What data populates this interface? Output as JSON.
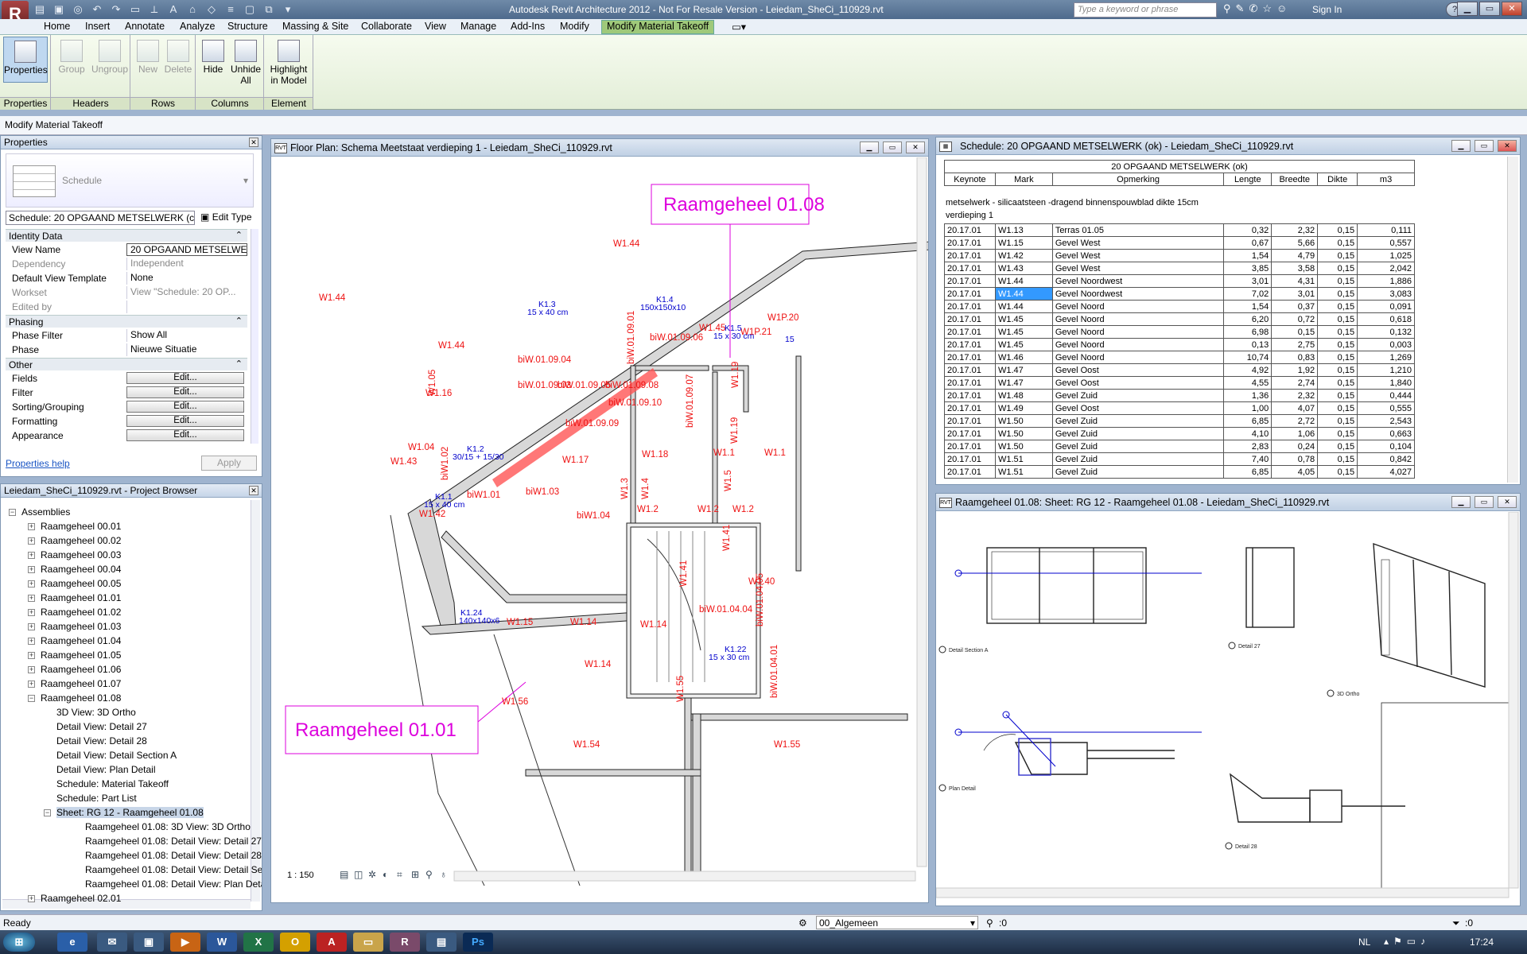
{
  "window": {
    "title": "Autodesk Revit Architecture 2012 - Not For Resale Version -    Leiedam_SheCi_110929.rvt",
    "search_placeholder": "Type a keyword or phrase",
    "sign_in": "Sign In",
    "logo": "R"
  },
  "tabs": [
    "Home",
    "Insert",
    "Annotate",
    "Analyze",
    "Structure",
    "Massing & Site",
    "Collaborate",
    "View",
    "Manage",
    "Add-Ins",
    "Modify",
    "Modify Material Takeoff"
  ],
  "ribbon": {
    "properties": {
      "btn": "Properties",
      "panel": "Properties"
    },
    "headers": {
      "group": "Group",
      "ungroup": "Ungroup",
      "panel": "Headers"
    },
    "rows": {
      "new": "New",
      "delete": "Delete",
      "panel": "Rows"
    },
    "columns": {
      "hide": "Hide",
      "unhide": "Unhide",
      "unhide2": "All",
      "panel": "Columns"
    },
    "element": {
      "highlight": "Highlight",
      "highlight2": "in Model",
      "panel": "Element"
    }
  },
  "context_label": "Modify Material Takeoff",
  "properties": {
    "title": "Properties",
    "type_name": "Schedule",
    "selector": "Schedule: 20 OPGAAND METSELWERK (c",
    "edit_type": "Edit Type",
    "groups": {
      "identity": "Identity Data",
      "phasing": "Phasing",
      "other": "Other"
    },
    "rows": [
      {
        "k": "View Name",
        "v": "20 OPGAAND METSELWE..."
      },
      {
        "k": "Dependency",
        "v": "Independent"
      },
      {
        "k": "Default View Template",
        "v": "None"
      },
      {
        "k": "Workset",
        "v": "View \"Schedule: 20 OP..."
      },
      {
        "k": "Edited by",
        "v": ""
      },
      {
        "k": "Phase Filter",
        "v": "Show All"
      },
      {
        "k": "Phase",
        "v": "Nieuwe Situatie"
      }
    ],
    "edit_rows": [
      "Fields",
      "Filter",
      "Sorting/Grouping",
      "Formatting",
      "Appearance"
    ],
    "edit_label": "Edit...",
    "help": "Properties help",
    "apply": "Apply"
  },
  "browser": {
    "title": "Leiedam_SheCi_110929.rvt - Project Browser",
    "root": "Assemblies",
    "items": [
      "Raamgeheel 00.01",
      "Raamgeheel 00.02",
      "Raamgeheel 00.03",
      "Raamgeheel 00.04",
      "Raamgeheel 00.05",
      "Raamgeheel 01.01",
      "Raamgeheel 01.02",
      "Raamgeheel 01.03",
      "Raamgeheel 01.04",
      "Raamgeheel 01.05",
      "Raamgeheel 01.06",
      "Raamgeheel 01.07",
      "Raamgeheel 01.08"
    ],
    "children": [
      "3D View: 3D Ortho",
      "Detail View: Detail 27",
      "Detail View: Detail 28",
      "Detail View: Detail Section A",
      "Detail View: Plan Detail",
      "Schedule: Material Takeoff",
      "Schedule: Part List"
    ],
    "sheet": "Sheet: RG 12 - Raamgeheel 01.08",
    "sheet_children": [
      "Raamgeheel 01.08: 3D View: 3D Ortho",
      "Raamgeheel 01.08: Detail View: Detail 27",
      "Raamgeheel 01.08: Detail View: Detail 28",
      "Raamgeheel 01.08: Detail View: Detail Section A",
      "Raamgeheel 01.08: Detail View: Plan Detail"
    ],
    "last": "Raamgeheel 02.01"
  },
  "floorplan": {
    "title": "Floor Plan: Schema Meetstaat verdieping 1 - Leiedam_SheCi_110929.rvt",
    "scale": "1 : 150",
    "tag1": "Raamgeheel 01.08",
    "tag2": "Raamgeheel 01.01",
    "labels": [
      "W1.44",
      "W1.44",
      "W1.44",
      "W1.43",
      "W1.16",
      "W1.04",
      "W1.42",
      "W1.05",
      "biW1.02",
      "biW1.01",
      "biW1.03",
      "biW1.04",
      "W1.17",
      "W1.18",
      "W1.1",
      "W1.1",
      "W1.3",
      "W1.4",
      "W1.5",
      "W1.2",
      "W1.2",
      "W1.2",
      "W1.45",
      "W1P.21",
      "W1P.20",
      "W1.19",
      "W1.19",
      "W1.41",
      "W1.41",
      "W1.40",
      "W1.15",
      "W1.14",
      "W1.14",
      "W1.14",
      "W1.55",
      "W1.56",
      "W1.54",
      "W1.55",
      "biW.01.09.04",
      "biW.01.09.03",
      "biW.01.09.05",
      "biW.01.09.06",
      "biW.01.09.08",
      "biW.01.09.09",
      "biW.01.09.10",
      "biW.01.09.01",
      "biW.01.09.07",
      "biW.01.04.04",
      "biW.01.04.05",
      "biW.01.04.01"
    ],
    "blue": [
      "K1.3",
      "15 x 40 cm",
      "K1.4",
      "150x150x10",
      "K1.5",
      "15 x 30 cm",
      "K1.2",
      "30/15 + 15/30",
      "K1.1",
      "15 x 40 cm",
      "K1.24",
      "140x140x6",
      "K1.22",
      "15 x 30 cm",
      "15"
    ]
  },
  "schedule": {
    "window_title": "Schedule: 20 OPGAAND METSELWERK (ok) - Leiedam_SheCi_110929.rvt",
    "title": "20 OPGAAND METSELWERK (ok)",
    "columns": [
      "Keynote",
      "Mark",
      "Opmerking",
      "Lengte",
      "Breedte",
      "Dikte",
      "m3"
    ],
    "group": "metselwerk - silicaatsteen -dragend binnenspouwblad dikte 15cm",
    "level": "verdieping 1",
    "rows": [
      [
        "20.17.01",
        "W1.13",
        "Terras 01.05",
        "0,32",
        "2,32",
        "0,15",
        "0,111"
      ],
      [
        "20.17.01",
        "W1.15",
        "Gevel West",
        "0,67",
        "5,66",
        "0,15",
        "0,557"
      ],
      [
        "20.17.01",
        "W1.42",
        "Gevel West",
        "1,54",
        "4,79",
        "0,15",
        "1,025"
      ],
      [
        "20.17.01",
        "W1.43",
        "Gevel West",
        "3,85",
        "3,58",
        "0,15",
        "2,042"
      ],
      [
        "20.17.01",
        "W1.44",
        "Gevel Noordwest",
        "3,01",
        "4,31",
        "0,15",
        "1,886"
      ],
      [
        "20.17.01",
        "W1.44",
        "Gevel Noordwest",
        "7,02",
        "3,01",
        "0,15",
        "3,083"
      ],
      [
        "20.17.01",
        "W1.44",
        "Gevel Noord",
        "1,54",
        "0,37",
        "0,15",
        "0,091"
      ],
      [
        "20.17.01",
        "W1.45",
        "Gevel Noord",
        "6,20",
        "0,72",
        "0,15",
        "0,618"
      ],
      [
        "20.17.01",
        "W1.45",
        "Gevel Noord",
        "6,98",
        "0,15",
        "0,15",
        "0,132"
      ],
      [
        "20.17.01",
        "W1.45",
        "Gevel Noord",
        "0,13",
        "2,75",
        "0,15",
        "0,003"
      ],
      [
        "20.17.01",
        "W1.46",
        "Gevel Noord",
        "10,74",
        "0,83",
        "0,15",
        "1,269"
      ],
      [
        "20.17.01",
        "W1.47",
        "Gevel Oost",
        "4,92",
        "1,92",
        "0,15",
        "1,210"
      ],
      [
        "20.17.01",
        "W1.47",
        "Gevel Oost",
        "4,55",
        "2,74",
        "0,15",
        "1,840"
      ],
      [
        "20.17.01",
        "W1.48",
        "Gevel Zuid",
        "1,36",
        "2,32",
        "0,15",
        "0,444"
      ],
      [
        "20.17.01",
        "W1.49",
        "Gevel Oost",
        "1,00",
        "4,07",
        "0,15",
        "0,555"
      ],
      [
        "20.17.01",
        "W1.50",
        "Gevel Zuid",
        "6,85",
        "2,72",
        "0,15",
        "2,543"
      ],
      [
        "20.17.01",
        "W1.50",
        "Gevel Zuid",
        "4,10",
        "1,06",
        "0,15",
        "0,663"
      ],
      [
        "20.17.01",
        "W1.50",
        "Gevel Zuid",
        "2,83",
        "0,24",
        "0,15",
        "0,104"
      ],
      [
        "20.17.01",
        "W1.51",
        "Gevel Zuid",
        "7,40",
        "0,78",
        "0,15",
        "0,842"
      ],
      [
        "20.17.01",
        "W1.51",
        "Gevel Zuid",
        "6,85",
        "4,05",
        "0,15",
        "4,027"
      ]
    ],
    "selected_mark_row": 5
  },
  "sheet": {
    "window_title": "Raamgeheel 01.08: Sheet: RG 12 - Raamgeheel 01.08 - Leiedam_SheCi_110929.rvt",
    "vp_labels": [
      "Detail Section A",
      "Detail 27",
      "3D Ortho",
      "Plan Detail",
      "Detail 28"
    ]
  },
  "status": {
    "text": "Ready",
    "workset": "00_Algemeen",
    "count1": ":0",
    "count2": ":0"
  },
  "taskbar": {
    "lang": "NL",
    "time": "17:24"
  },
  "colors": {
    "ribbon_active": "#9fc97a",
    "plan_text": "#e11111",
    "tag": "#dd00dd",
    "highlight": "#ff5555"
  }
}
